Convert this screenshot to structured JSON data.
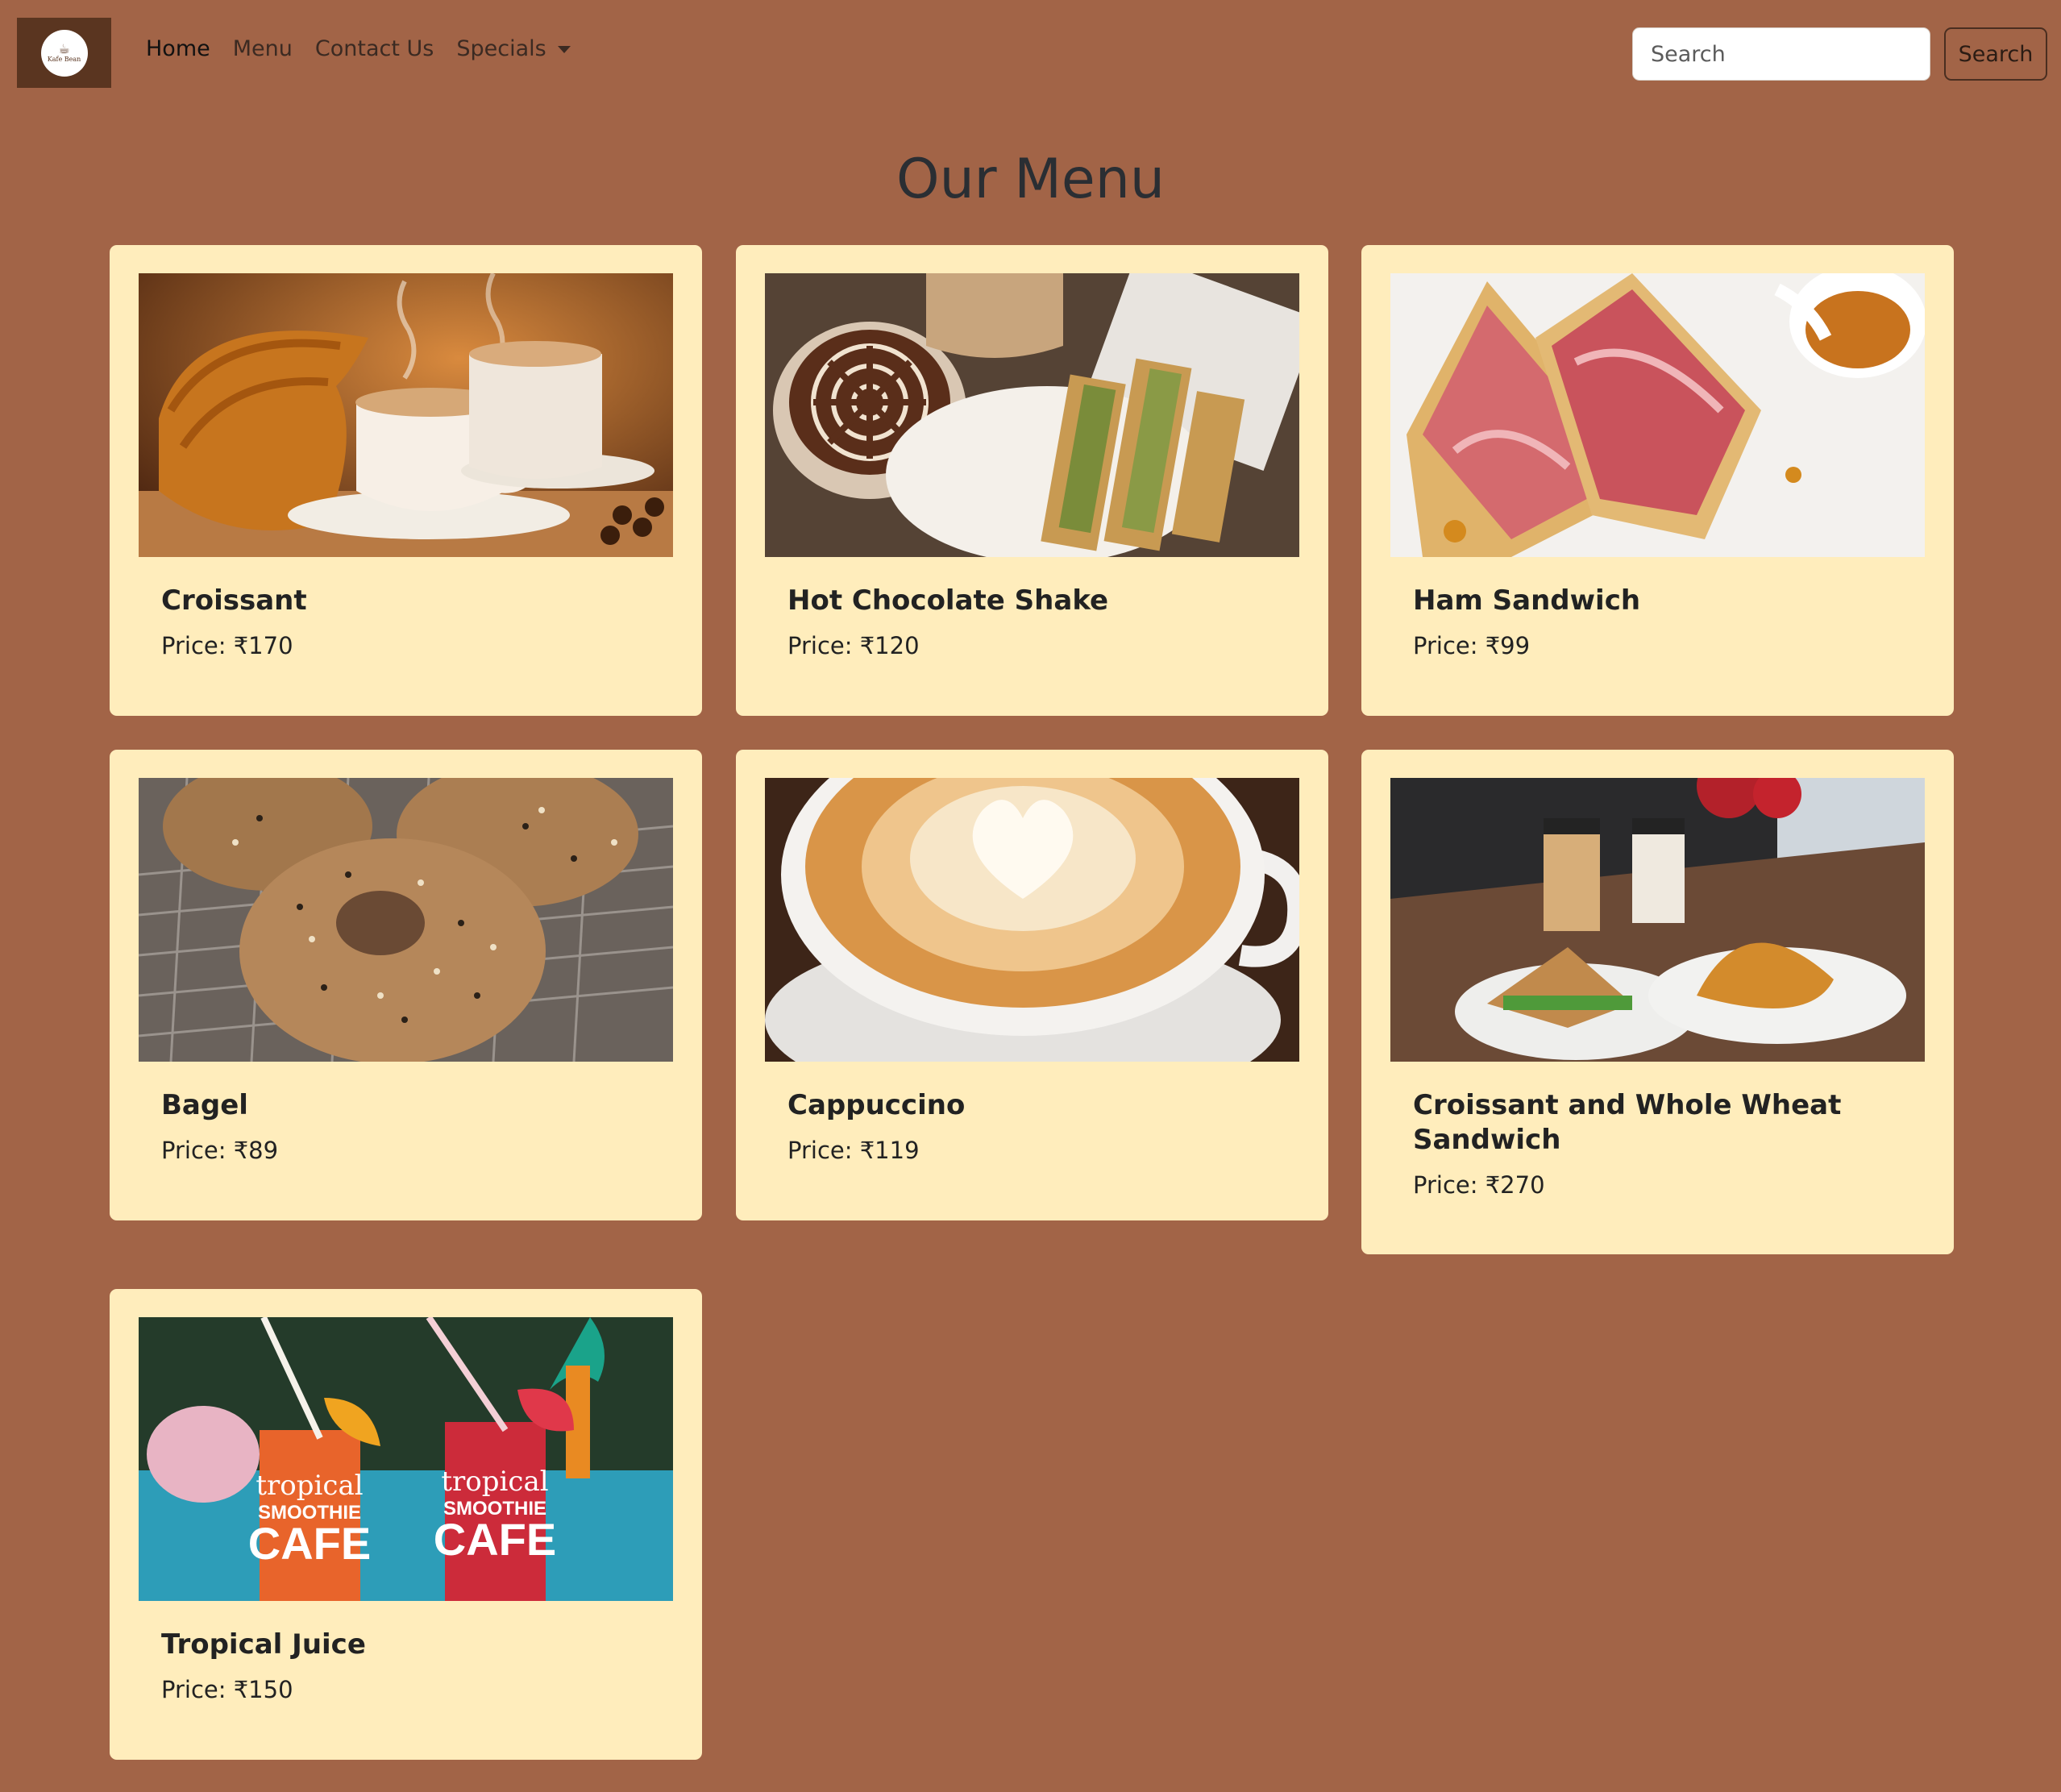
{
  "navbar": {
    "logo_text": "Kafe Bean",
    "links": [
      {
        "label": "Home",
        "active": true
      },
      {
        "label": "Menu",
        "active": false
      },
      {
        "label": "Contact Us",
        "active": false
      },
      {
        "label": "Specials",
        "active": false,
        "dropdown": true
      }
    ],
    "search": {
      "placeholder": "Search",
      "button_label": "Search"
    }
  },
  "page": {
    "title": "Our Menu"
  },
  "menu": {
    "items": [
      {
        "name": "Croissant",
        "price": "Price: ₹170",
        "image": "croissant-coffee-image"
      },
      {
        "name": "Hot Chocolate Shake",
        "price": "Price: ₹120",
        "image": "hot-chocolate-sandwich-image"
      },
      {
        "name": "Ham Sandwich",
        "price": "Price: ₹99",
        "image": "ham-sandwich-image"
      },
      {
        "name": "Bagel",
        "price": "Price: ₹89",
        "image": "bagel-image"
      },
      {
        "name": "Cappuccino",
        "price": "Price: ₹119",
        "image": "cappuccino-image"
      },
      {
        "name": "Croissant and Whole Wheat Sandwich",
        "price": "Price: ₹270",
        "image": "croissant-sandwich-combo-image"
      },
      {
        "name": "Tropical Juice",
        "price": "Price: ₹150",
        "image": "tropical-juice-image",
        "image_text": [
          "tropical",
          "SMOOTHIE",
          "CAFE"
        ]
      }
    ]
  },
  "colors": {
    "page_background": "#a26447",
    "card_background": "#ffedbc",
    "logo_background": "#5a3520"
  }
}
